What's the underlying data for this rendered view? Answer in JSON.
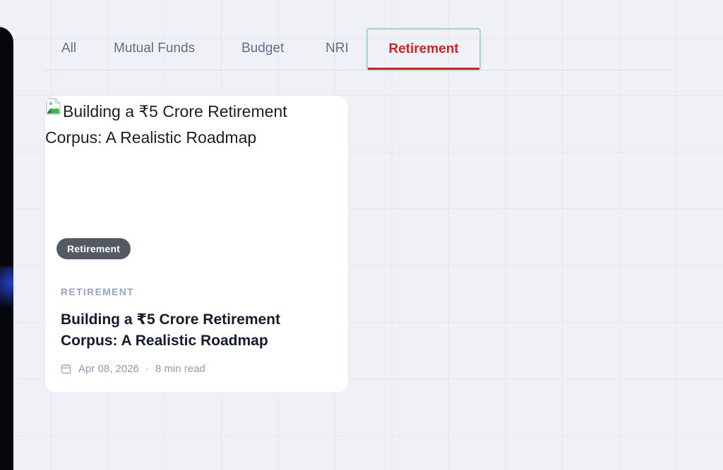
{
  "tabs": [
    {
      "label": "All",
      "active": false
    },
    {
      "label": "Mutual Funds",
      "active": false
    },
    {
      "label": "Budget",
      "active": false
    },
    {
      "label": "NRI",
      "active": false
    },
    {
      "label": "Retirement",
      "active": true
    }
  ],
  "card": {
    "image_alt": "Building a ₹5 Crore Retirement Corpus: A Realistic Roadmap",
    "image_icon": "broken-image-icon",
    "badge": "Retirement",
    "category": "RETIREMENT",
    "title": "Building a ₹5 Crore Retirement Corpus: A Realistic Roadmap",
    "date": "Apr 08, 2026",
    "separator": "·",
    "read_time": "8 min read",
    "date_icon": "calendar-icon"
  },
  "colors": {
    "active_tab": "#c7262a",
    "active_tab_border": "#a7dcc6",
    "tab_text": "#5f6f86",
    "badge_bg": "#545a64",
    "title": "#151b2c"
  }
}
